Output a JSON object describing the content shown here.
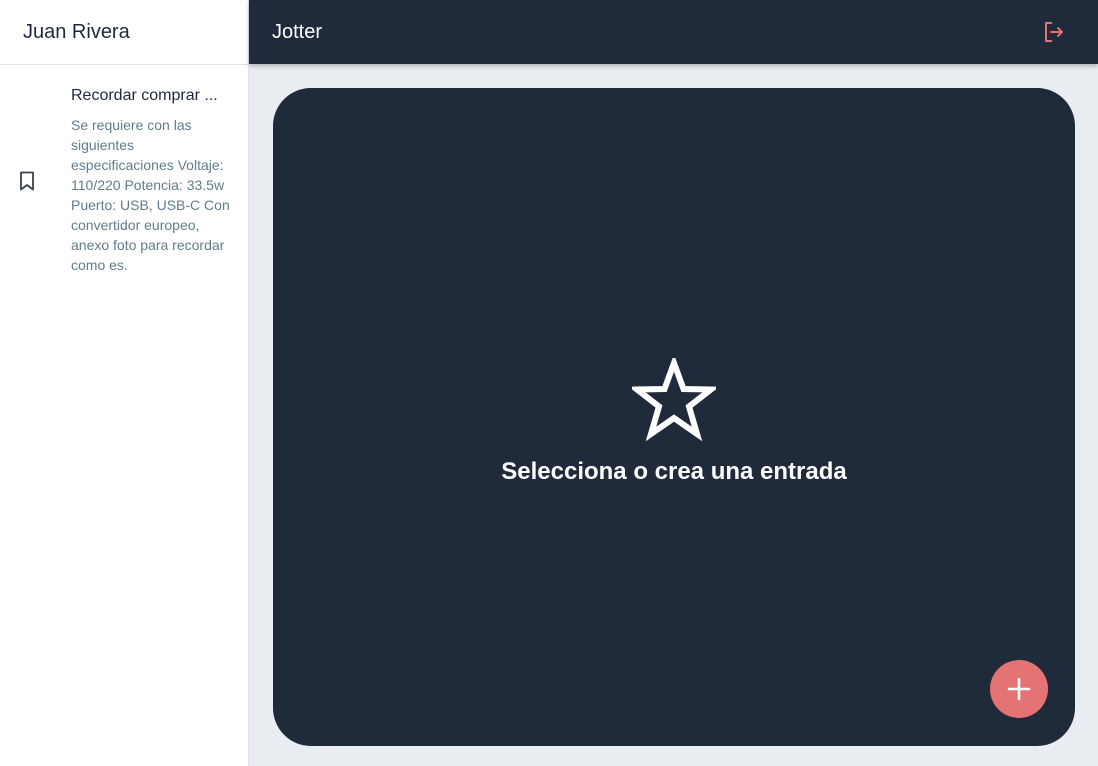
{
  "sidebar": {
    "user_name": "Juan Rivera",
    "entries": [
      {
        "icon": "bookmark-icon",
        "title": "Recordar comprar ...",
        "text": "Se requiere con las siguientes especificaciones Voltaje: 110/220 Potencia: 33.5w Puerto: USB, USB-C Con convertidor europeo, anexo foto para recordar como es."
      }
    ]
  },
  "appbar": {
    "title": "Jotter",
    "logout_icon": "logout-icon"
  },
  "main": {
    "empty_icon": "star-icon",
    "empty_message": "Selecciona o crea una entrada",
    "fab_icon": "add-icon"
  },
  "colors": {
    "dark": "#1f2a3b",
    "accent": "#e57373",
    "muted_text": "#607d8b",
    "background": "#e9edf1"
  }
}
